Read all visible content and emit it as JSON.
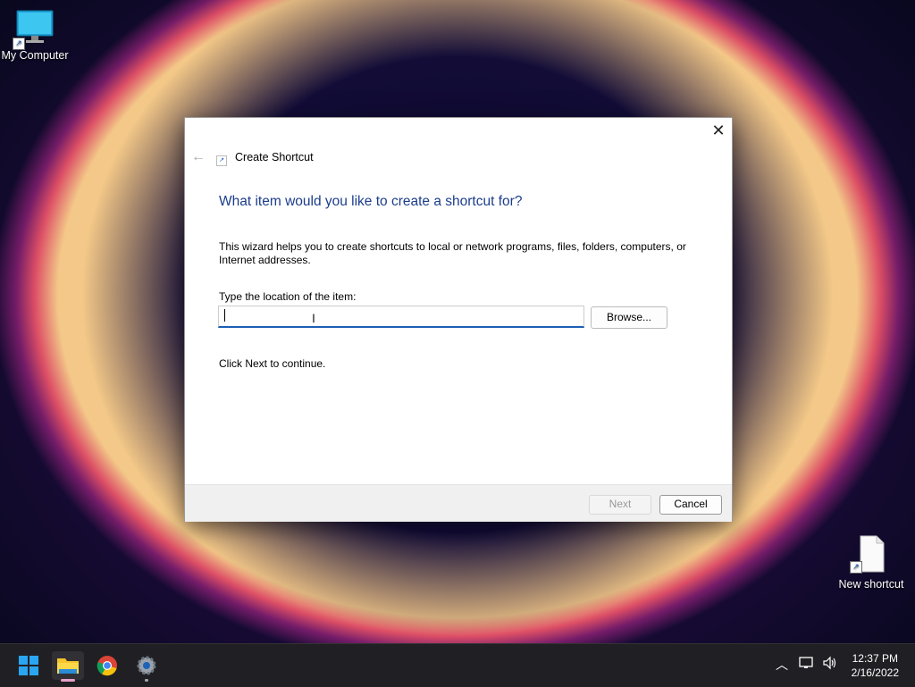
{
  "desktop": {
    "icons": [
      {
        "label": "My Computer"
      },
      {
        "label": "New shortcut"
      }
    ]
  },
  "dialog": {
    "title": "Create Shortcut",
    "heading": "What item would you like to create a shortcut for?",
    "description": "This wizard helps you to create shortcuts to local or network programs, files, folders, computers, or Internet addresses.",
    "input_label": "Type the location of the item:",
    "input_value": "",
    "browse_label": "Browse...",
    "hint": "Click Next to continue.",
    "next_label": "Next",
    "cancel_label": "Cancel"
  },
  "taskbar": {
    "apps": [
      "start-icon",
      "file-explorer-icon",
      "chrome-icon",
      "settings-icon"
    ],
    "time": "12:37 PM",
    "date": "2/16/2022"
  },
  "colors": {
    "accent": "#1a5fb4",
    "heading": "#1c3d8c",
    "taskbar": "#202024"
  }
}
